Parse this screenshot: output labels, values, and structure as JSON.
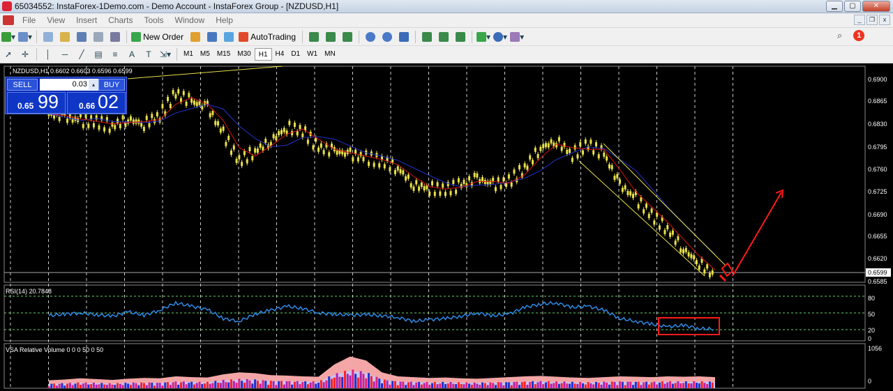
{
  "window": {
    "title": "65034552: InstaForex-1Demo.com - Demo Account - InstaForex Group - [NZDUSD,H1]",
    "minimize_icon": "minimize-icon",
    "maximize_icon": "maximize-icon",
    "close_icon": "close-icon"
  },
  "menu": {
    "items": [
      "File",
      "View",
      "Insert",
      "Charts",
      "Tools",
      "Window",
      "Help"
    ]
  },
  "notification_badge": "1",
  "toolbar": {
    "new_order_label": "New Order",
    "autotrading_label": "AutoTrading"
  },
  "timeframes": [
    "M1",
    "M5",
    "M15",
    "M30",
    "H1",
    "H4",
    "D1",
    "W1",
    "MN"
  ],
  "active_timeframe": "H1",
  "main_chart": {
    "header": "NZDUSD,H1  0.6602 0.6603 0.6596 0.6599",
    "price_levels": [
      "0.6900",
      "0.6865",
      "0.6830",
      "0.6795",
      "0.6760",
      "0.6725",
      "0.6690",
      "0.6655",
      "0.6620",
      "0.6585"
    ],
    "current_price": "0.6599"
  },
  "trade_panel": {
    "sell_label": "SELL",
    "buy_label": "BUY",
    "lot": "0.03",
    "bid_small": "0.65",
    "bid_big": "99",
    "ask_small": "0.66",
    "ask_big": "02"
  },
  "rsi": {
    "header": "RSI(14) 20.7848",
    "levels": [
      "80",
      "50",
      "20",
      "0"
    ]
  },
  "volume": {
    "header": "VSA Relative Volume 0 0 0 50 0 50",
    "levels": [
      "1056",
      "0"
    ]
  },
  "colors": {
    "candle": "#e8e04a",
    "ma_fast": "#d11",
    "ma_slow": "#2233cc",
    "rsi_line": "#2e8ae6",
    "level_line": "#6bd36b",
    "annotation": "#ff1a1a",
    "trendline": "#e8e04a"
  },
  "chart_data": {
    "type": "line",
    "price_series": [
      0.684,
      0.6835,
      0.683,
      0.6828,
      0.6822,
      0.6832,
      0.6825,
      0.6838,
      0.687,
      0.6858,
      0.685,
      0.681,
      0.677,
      0.6785,
      0.68,
      0.682,
      0.6815,
      0.679,
      0.6785,
      0.678,
      0.6775,
      0.677,
      0.676,
      0.6735,
      0.673,
      0.6728,
      0.6735,
      0.6745,
      0.6735,
      0.674,
      0.676,
      0.679,
      0.68,
      0.678,
      0.6795,
      0.678,
      0.6735,
      0.6715,
      0.669,
      0.667,
      0.664,
      0.662,
      0.6599
    ],
    "rsi_series": [
      45,
      48,
      50,
      47,
      44,
      52,
      46,
      55,
      68,
      62,
      56,
      40,
      35,
      48,
      55,
      62,
      58,
      50,
      48,
      46,
      47,
      45,
      42,
      35,
      38,
      40,
      44,
      50,
      45,
      48,
      60,
      66,
      68,
      60,
      62,
      55,
      40,
      35,
      30,
      25,
      28,
      22,
      20.78
    ],
    "volume_series": [
      200,
      220,
      250,
      230,
      210,
      240,
      260,
      250,
      300,
      280,
      270,
      350,
      400,
      380,
      330,
      320,
      300,
      290,
      600,
      800,
      700,
      400,
      300,
      280,
      260,
      270,
      250,
      240,
      260,
      280,
      300,
      310,
      290,
      270,
      260,
      280,
      300,
      290,
      280,
      300,
      290,
      300,
      280
    ],
    "ylim_price": [
      0.6585,
      0.69
    ],
    "ylim_rsi": [
      0,
      100
    ],
    "ylim_volume": [
      0,
      1056
    ]
  }
}
